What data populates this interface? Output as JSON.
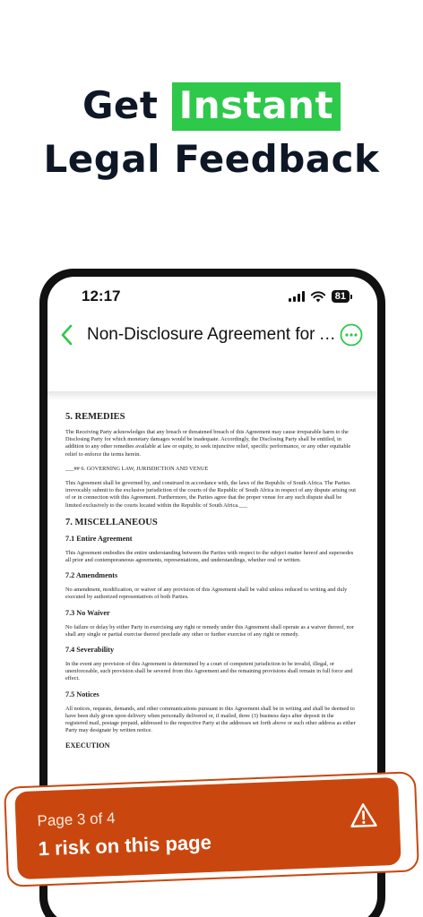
{
  "headline": {
    "line1_plain": "Get",
    "line1_highlight": "Instant",
    "line2": "Legal Feedback",
    "highlight_color": "#2ec84a"
  },
  "status_bar": {
    "time": "12:17",
    "battery": "81"
  },
  "nav": {
    "title": "Non-Disclosure Agreement for Ap...",
    "accent_color": "#2ec84a",
    "back_icon": "chevron-left-icon",
    "more_icon": "more-horizontal-icon"
  },
  "document": {
    "remedies_heading": "5. REMEDIES",
    "remedies_text": "The Receiving Party acknowledges that any breach or threatened breach of this Agreement may cause irreparable harm to the Disclosing Party for which monetary damages would be inadequate. Accordingly, the Disclosing Party shall be entitled, in addition to any other remedies available at law or equity, to seek injunctive relief, specific performance, or any other equitable relief to enforce the terms herein.",
    "governing_line": "___## 6. GOVERNING LAW, JURISDICTION AND VENUE",
    "governing_text": "This Agreement shall be governed by, and construed in accordance with, the laws of the Republic of South Africa. The Parties irrevocably submit to the exclusive jurisdiction of the courts of the Republic of South Africa in respect of any dispute arising out of or in connection with this Agreement. Furthermore, the Parties agree that the proper venue for any such dispute shall be limited exclusively to the courts located within the Republic of South Africa.___",
    "misc_heading": "7. MISCELLANEOUS",
    "s71_heading": "7.1 Entire Agreement",
    "s71_text": "This Agreement embodies the entire understanding between the Parties with respect to the subject matter hereof and supersedes all prior and contemporaneous agreements, representations, and understandings, whether oral or written.",
    "s72_heading": "7.2 Amendments",
    "s72_text": "No amendment, modification, or waiver of any provision of this Agreement shall be valid unless reduced to writing and duly executed by authorized representatives of both Parties.",
    "s73_heading": "7.3 No Waiver",
    "s73_text": "No failure or delay by either Party in exercising any right or remedy under this Agreement shall operate as a waiver thereof, nor shall any single or partial exercise thereof preclude any other or further exercise of any right or remedy.",
    "s74_heading": "7.4 Severability",
    "s74_text": "In the event any provision of this Agreement is determined by a court of competent jurisdiction to be invalid, illegal, or unenforceable, such provision shall be severed from this Agreement and the remaining provisions shall remain in full force and effect.",
    "s75_heading": "7.5 Notices",
    "s75_text": "All notices, requests, demands, and other communications pursuant to this Agreement shall be in writing and shall be deemed to have been duly given upon delivery when personally delivered or, if mailed, three (3) business days after deposit in the registered mail, postage prepaid, addressed to the respective Party at the addresses set forth above or such other address as either Party may designate by written notice.",
    "execution_heading": "EXECUTION"
  },
  "risk_banner": {
    "page_label": "Page 3 of 4",
    "risk_label": "1 risk on this page",
    "color": "#c9470f",
    "icon": "warning-triangle-icon"
  }
}
